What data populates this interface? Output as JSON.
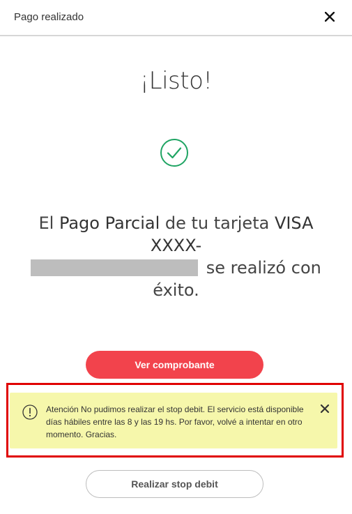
{
  "header": {
    "title": "Pago realizado",
    "close_icon": "close-icon"
  },
  "headline": "¡Listo!",
  "success_icon": "check-circle-icon",
  "colors": {
    "accent": "#f2434c",
    "success": "#1fa463",
    "alert_bg": "#f6f7ab",
    "alert_outline": "#e00000"
  },
  "message": {
    "part1": "El ",
    "strong1": "Pago Parcial",
    "part2": " de tu tarjeta ",
    "strong2": "VISA XXXX-",
    "part3": " se realizó con éxito."
  },
  "primary_button": {
    "label": "Ver comprobante"
  },
  "alert": {
    "icon": "warning-circle-icon",
    "text": "Atención No pudimos realizar el stop debit. El servicio está disponible días hábiles entre las 8 y las 19 hs. Por favor, volvé a intentar en otro momento. Gracias.",
    "close_icon": "close-icon"
  },
  "secondary_button": {
    "label": "Realizar stop debit"
  }
}
